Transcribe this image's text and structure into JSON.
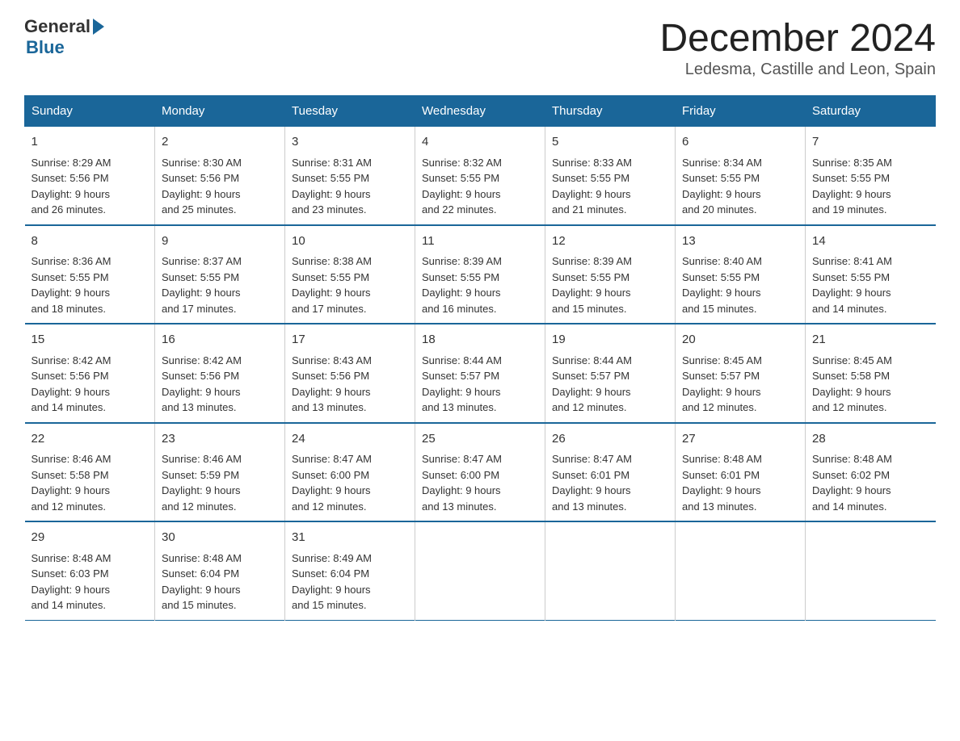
{
  "header": {
    "logo": {
      "general": "General",
      "blue": "Blue"
    },
    "title": "December 2024",
    "location": "Ledesma, Castille and Leon, Spain"
  },
  "weekdays": [
    "Sunday",
    "Monday",
    "Tuesday",
    "Wednesday",
    "Thursday",
    "Friday",
    "Saturday"
  ],
  "weeks": [
    [
      {
        "day": "1",
        "sunrise": "8:29 AM",
        "sunset": "5:56 PM",
        "daylight": "9 hours and 26 minutes."
      },
      {
        "day": "2",
        "sunrise": "8:30 AM",
        "sunset": "5:56 PM",
        "daylight": "9 hours and 25 minutes."
      },
      {
        "day": "3",
        "sunrise": "8:31 AM",
        "sunset": "5:55 PM",
        "daylight": "9 hours and 23 minutes."
      },
      {
        "day": "4",
        "sunrise": "8:32 AM",
        "sunset": "5:55 PM",
        "daylight": "9 hours and 22 minutes."
      },
      {
        "day": "5",
        "sunrise": "8:33 AM",
        "sunset": "5:55 PM",
        "daylight": "9 hours and 21 minutes."
      },
      {
        "day": "6",
        "sunrise": "8:34 AM",
        "sunset": "5:55 PM",
        "daylight": "9 hours and 20 minutes."
      },
      {
        "day": "7",
        "sunrise": "8:35 AM",
        "sunset": "5:55 PM",
        "daylight": "9 hours and 19 minutes."
      }
    ],
    [
      {
        "day": "8",
        "sunrise": "8:36 AM",
        "sunset": "5:55 PM",
        "daylight": "9 hours and 18 minutes."
      },
      {
        "day": "9",
        "sunrise": "8:37 AM",
        "sunset": "5:55 PM",
        "daylight": "9 hours and 17 minutes."
      },
      {
        "day": "10",
        "sunrise": "8:38 AM",
        "sunset": "5:55 PM",
        "daylight": "9 hours and 17 minutes."
      },
      {
        "day": "11",
        "sunrise": "8:39 AM",
        "sunset": "5:55 PM",
        "daylight": "9 hours and 16 minutes."
      },
      {
        "day": "12",
        "sunrise": "8:39 AM",
        "sunset": "5:55 PM",
        "daylight": "9 hours and 15 minutes."
      },
      {
        "day": "13",
        "sunrise": "8:40 AM",
        "sunset": "5:55 PM",
        "daylight": "9 hours and 15 minutes."
      },
      {
        "day": "14",
        "sunrise": "8:41 AM",
        "sunset": "5:55 PM",
        "daylight": "9 hours and 14 minutes."
      }
    ],
    [
      {
        "day": "15",
        "sunrise": "8:42 AM",
        "sunset": "5:56 PM",
        "daylight": "9 hours and 14 minutes."
      },
      {
        "day": "16",
        "sunrise": "8:42 AM",
        "sunset": "5:56 PM",
        "daylight": "9 hours and 13 minutes."
      },
      {
        "day": "17",
        "sunrise": "8:43 AM",
        "sunset": "5:56 PM",
        "daylight": "9 hours and 13 minutes."
      },
      {
        "day": "18",
        "sunrise": "8:44 AM",
        "sunset": "5:57 PM",
        "daylight": "9 hours and 13 minutes."
      },
      {
        "day": "19",
        "sunrise": "8:44 AM",
        "sunset": "5:57 PM",
        "daylight": "9 hours and 12 minutes."
      },
      {
        "day": "20",
        "sunrise": "8:45 AM",
        "sunset": "5:57 PM",
        "daylight": "9 hours and 12 minutes."
      },
      {
        "day": "21",
        "sunrise": "8:45 AM",
        "sunset": "5:58 PM",
        "daylight": "9 hours and 12 minutes."
      }
    ],
    [
      {
        "day": "22",
        "sunrise": "8:46 AM",
        "sunset": "5:58 PM",
        "daylight": "9 hours and 12 minutes."
      },
      {
        "day": "23",
        "sunrise": "8:46 AM",
        "sunset": "5:59 PM",
        "daylight": "9 hours and 12 minutes."
      },
      {
        "day": "24",
        "sunrise": "8:47 AM",
        "sunset": "6:00 PM",
        "daylight": "9 hours and 12 minutes."
      },
      {
        "day": "25",
        "sunrise": "8:47 AM",
        "sunset": "6:00 PM",
        "daylight": "9 hours and 13 minutes."
      },
      {
        "day": "26",
        "sunrise": "8:47 AM",
        "sunset": "6:01 PM",
        "daylight": "9 hours and 13 minutes."
      },
      {
        "day": "27",
        "sunrise": "8:48 AM",
        "sunset": "6:01 PM",
        "daylight": "9 hours and 13 minutes."
      },
      {
        "day": "28",
        "sunrise": "8:48 AM",
        "sunset": "6:02 PM",
        "daylight": "9 hours and 14 minutes."
      }
    ],
    [
      {
        "day": "29",
        "sunrise": "8:48 AM",
        "sunset": "6:03 PM",
        "daylight": "9 hours and 14 minutes."
      },
      {
        "day": "30",
        "sunrise": "8:48 AM",
        "sunset": "6:04 PM",
        "daylight": "9 hours and 15 minutes."
      },
      {
        "day": "31",
        "sunrise": "8:49 AM",
        "sunset": "6:04 PM",
        "daylight": "9 hours and 15 minutes."
      },
      null,
      null,
      null,
      null
    ]
  ],
  "labels": {
    "sunrise": "Sunrise:",
    "sunset": "Sunset:",
    "daylight": "Daylight:"
  }
}
